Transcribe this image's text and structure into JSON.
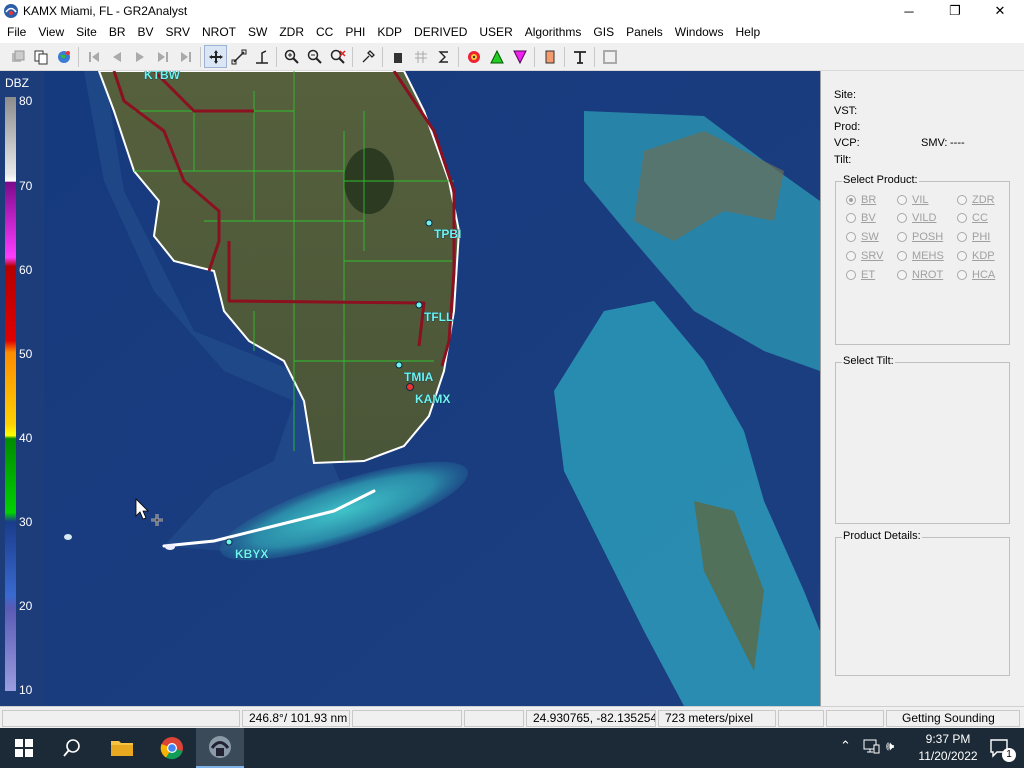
{
  "window": {
    "title": "KAMX Miami, FL - GR2Analyst",
    "minimize": "─",
    "maximize": "❐",
    "close": "✕"
  },
  "menu": [
    "File",
    "View",
    "Site",
    "BR",
    "BV",
    "SRV",
    "NROT",
    "SW",
    "ZDR",
    "CC",
    "PHI",
    "KDP",
    "DERIVED",
    "USER",
    "Algorithms",
    "GIS",
    "Panels",
    "Windows",
    "Help"
  ],
  "legend": {
    "title": "DBZ",
    "ticks": [
      "80",
      "70",
      "60",
      "50",
      "40",
      "30",
      "20",
      "10"
    ]
  },
  "map": {
    "sites": [
      "KTBW",
      "TPBI",
      "TFLL",
      "TMIA",
      "KAMX",
      "KBYX"
    ]
  },
  "panel": {
    "site_label": "Site:",
    "vst_label": "VST:",
    "prod_label": "Prod:",
    "vcp_label": "VCP:",
    "smv_label": "SMV:",
    "smv_value": "----",
    "tilt_label": "Tilt:",
    "select_product": "Select Product:",
    "products": [
      "BR",
      "VIL",
      "ZDR",
      "BV",
      "VILD",
      "CC",
      "SW",
      "POSH",
      "PHI",
      "SRV",
      "MEHS",
      "KDP",
      "ET",
      "NROT",
      "HCA"
    ],
    "selected_product": "BR",
    "select_tilt": "Select Tilt:",
    "product_details": "Product Details:"
  },
  "status": {
    "bearing": "246.8°/ 101.93 nm",
    "coords": "24.930765, -82.135254",
    "scale": "723 meters/pixel",
    "message": "Getting Sounding"
  },
  "taskbar": {
    "time": "9:37 PM",
    "date": "11/20/2022",
    "notification_count": "1"
  },
  "colors": {
    "ocean": "#1a3c7c",
    "land": "#4f5a37",
    "coast": "#ffffff",
    "roads": "#8b1020",
    "counties": "#2fbf2f",
    "site_label": "#6ff3ef"
  }
}
